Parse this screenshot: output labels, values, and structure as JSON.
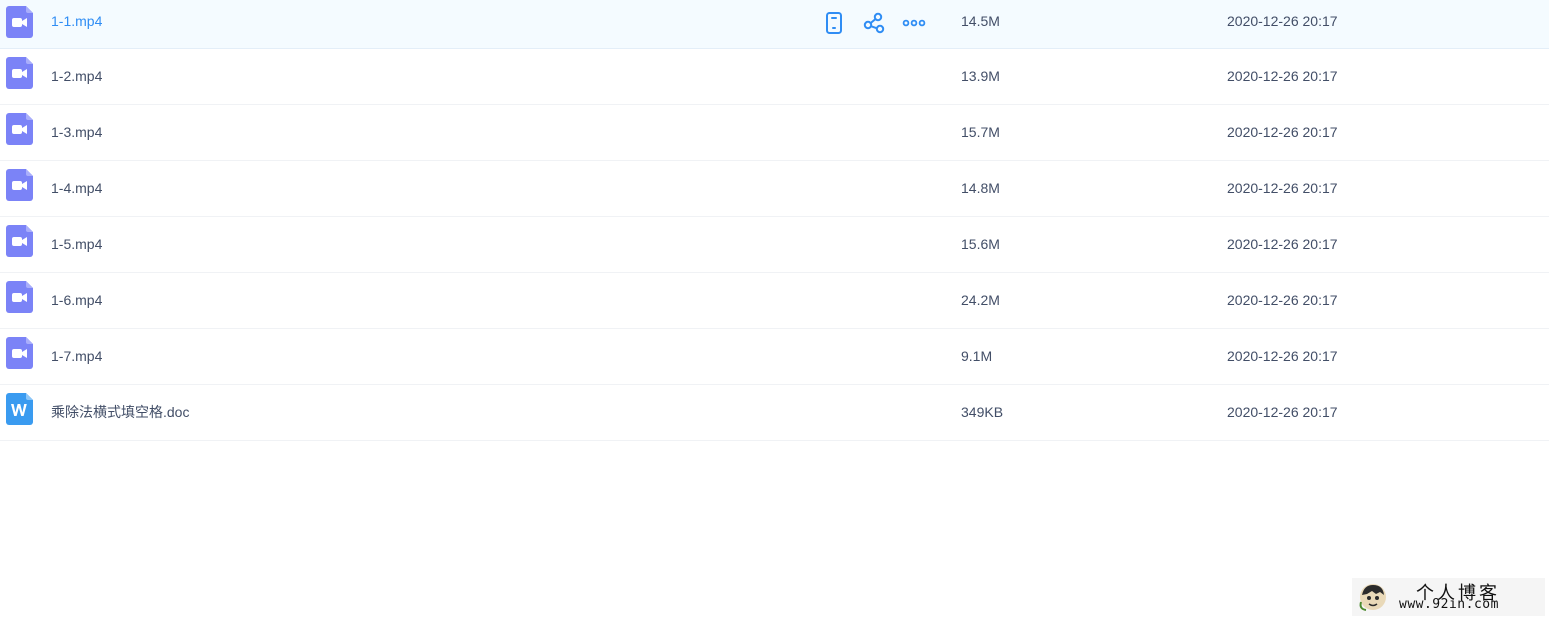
{
  "files": [
    {
      "name": "1-1.mp4",
      "size": "14.5M",
      "date": "2020-12-26 20:17",
      "type": "video-icon"
    },
    {
      "name": "1-2.mp4",
      "size": "13.9M",
      "date": "2020-12-26 20:17",
      "type": "video-icon"
    },
    {
      "name": "1-3.mp4",
      "size": "15.7M",
      "date": "2020-12-26 20:17",
      "type": "video-icon"
    },
    {
      "name": "1-4.mp4",
      "size": "14.8M",
      "date": "2020-12-26 20:17",
      "type": "video-icon"
    },
    {
      "name": "1-5.mp4",
      "size": "15.6M",
      "date": "2020-12-26 20:17",
      "type": "video-icon"
    },
    {
      "name": "1-6.mp4",
      "size": "24.2M",
      "date": "2020-12-26 20:17",
      "type": "video-icon"
    },
    {
      "name": "1-7.mp4",
      "size": "9.1M",
      "date": "2020-12-26 20:17",
      "type": "video-icon"
    },
    {
      "name": "乘除法横式填空格.doc",
      "size": "349KB",
      "date": "2020-12-26 20:17",
      "type": "word-doc-icon"
    }
  ],
  "row_actions": [
    "phone-icon",
    "share-icon",
    "more-icon"
  ],
  "colors": {
    "accent": "#2f8df4",
    "video_icon": "#7b83f7",
    "word_icon": "#3a9bf0",
    "hover_row": "#f4fbff",
    "text": "#424e67"
  },
  "watermark": {
    "title": "个人博客",
    "url": "www.92in.com"
  }
}
